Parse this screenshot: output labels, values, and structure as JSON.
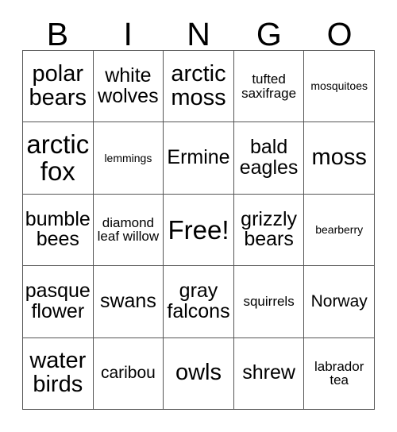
{
  "card": {
    "title": "BINGO",
    "headers": [
      "B",
      "I",
      "N",
      "G",
      "O"
    ],
    "rows": [
      [
        {
          "label": "polar bears",
          "size": "lg",
          "free": false
        },
        {
          "label": "white wolves",
          "size": "md",
          "free": false
        },
        {
          "label": "arctic moss",
          "size": "lg",
          "free": false
        },
        {
          "label": "tufted saxifrage",
          "size": "xs",
          "free": false
        },
        {
          "label": "mosquitoes",
          "size": "xxs",
          "free": false
        }
      ],
      [
        {
          "label": "arctic fox",
          "size": "xl",
          "free": false
        },
        {
          "label": "lemmings",
          "size": "xxs",
          "free": false
        },
        {
          "label": "Ermine",
          "size": "md",
          "free": false
        },
        {
          "label": "bald eagles",
          "size": "md",
          "free": false
        },
        {
          "label": "moss",
          "size": "lg",
          "free": false
        }
      ],
      [
        {
          "label": "bumble bees",
          "size": "md",
          "free": false
        },
        {
          "label": "diamond leaf willow",
          "size": "xs",
          "free": false
        },
        {
          "label": "Free!",
          "size": "xl",
          "free": true
        },
        {
          "label": "grizzly bears",
          "size": "md",
          "free": false
        },
        {
          "label": "bearberry",
          "size": "xxs",
          "free": false
        }
      ],
      [
        {
          "label": "pasque flower",
          "size": "md",
          "free": false
        },
        {
          "label": "swans",
          "size": "md",
          "free": false
        },
        {
          "label": "gray falcons",
          "size": "md",
          "free": false
        },
        {
          "label": "squirrels",
          "size": "xs",
          "free": false
        },
        {
          "label": "Norway",
          "size": "sm",
          "free": false
        }
      ],
      [
        {
          "label": "water birds",
          "size": "lg",
          "free": false
        },
        {
          "label": "caribou",
          "size": "sm",
          "free": false
        },
        {
          "label": "owls",
          "size": "lg",
          "free": false
        },
        {
          "label": "shrew",
          "size": "md",
          "free": false
        },
        {
          "label": "labrador tea",
          "size": "xs",
          "free": false
        }
      ]
    ]
  },
  "style": {
    "border_color": "#555555",
    "text_color": "#000000",
    "background_color": "#ffffff"
  }
}
